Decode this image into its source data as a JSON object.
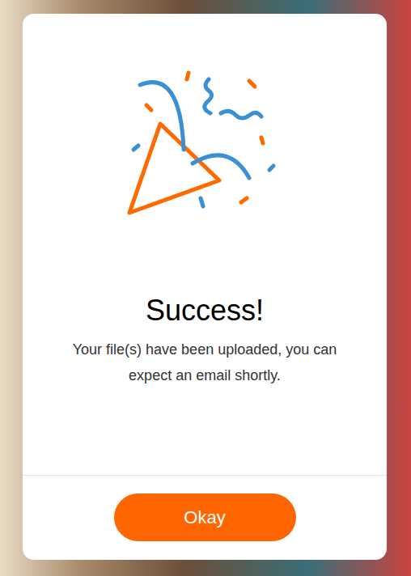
{
  "dialog": {
    "title": "Success!",
    "message": "Your file(s) have been uploaded, you can expect an email shortly.",
    "button": "Okay"
  }
}
